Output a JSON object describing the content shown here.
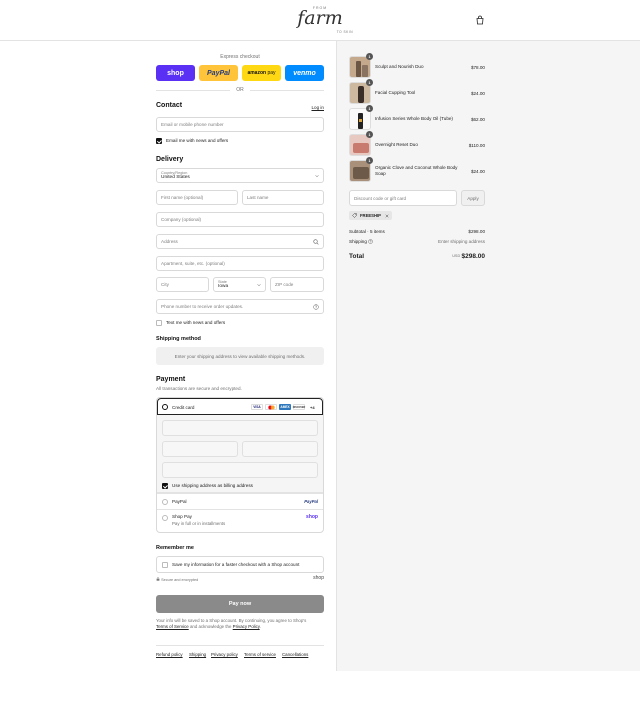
{
  "header": {
    "logo_text": "farm",
    "logo_top": "FROM",
    "logo_bottom": "TO SKIN",
    "cart_icon": "bag-icon"
  },
  "express": {
    "title": "Express checkout",
    "shop_label": "shop",
    "paypal_label": "PayPal",
    "amazon_label": "amazon",
    "amazon_sub": "pay",
    "venmo_label": "venmo",
    "or_label": "OR",
    "colors": {
      "shop": "#5a31f4",
      "paypal": "#ffc439",
      "amazon": "#ffd814",
      "venmo": "#008cff"
    }
  },
  "contact": {
    "heading": "Contact",
    "login_label": "Log in",
    "email_placeholder": "Email or mobile phone number",
    "news_label": "Email me with news and offers",
    "news_checked": true
  },
  "delivery": {
    "heading": "Delivery",
    "country_label": "Country/Region",
    "country_value": "United States",
    "first_name_placeholder": "First name (optional)",
    "last_name_placeholder": "Last name",
    "company_placeholder": "Company (optional)",
    "address_placeholder": "Address",
    "apartment_placeholder": "Apartment, suite, etc. (optional)",
    "city_placeholder": "City",
    "state_label": "State",
    "state_value": "Iowa",
    "zip_placeholder": "ZIP code",
    "phone_placeholder": "Phone number to receive order updates.",
    "text_label": "Text me with news and offers",
    "text_checked": false
  },
  "shipping_method": {
    "heading": "Shipping method",
    "notice": "Enter your shipping address to view available shipping methods."
  },
  "payment": {
    "heading": "Payment",
    "subtitle": "All transactions are secure and encrypted.",
    "credit_card_label": "Credit card",
    "card_brands": [
      "VISA",
      "MC",
      "AMEX",
      "DISCOVER"
    ],
    "more_brands": "+4",
    "billing_label": "Use shipping address as billing address",
    "billing_checked": true,
    "paypal_label": "PayPal",
    "paypal_logo": "PayPal",
    "shoppay_label": "Shop Pay",
    "shoppay_sub": "Pay in full or in installments",
    "shoppay_logo": "shop"
  },
  "remember": {
    "heading": "Remember me",
    "save_label": "Save my information for a faster checkout with a Shop account",
    "secure_label": "Secure and encrypted",
    "shop_logo": "shop"
  },
  "pay_now_label": "Pay now",
  "legal": {
    "line1": "Your info will be saved to a Shop account. By continuing, you agree to Shop's",
    "terms": "Terms of Service",
    "and": "and acknowledge the",
    "privacy": "Privacy Policy",
    "end": "."
  },
  "footer_links": [
    "Refund policy",
    "Shipping",
    "Privacy policy",
    "Terms of service",
    "Cancellations"
  ],
  "cart": {
    "items": [
      {
        "name": "Sculpt and Nourish Duo",
        "price": "$78.00",
        "qty": "1"
      },
      {
        "name": "Facial Cupping Tool",
        "price": "$24.00",
        "qty": "1"
      },
      {
        "name": "Infusion Series Whole Body Oil (Tube)",
        "price": "$62.00",
        "qty": "1"
      },
      {
        "name": "Overnight Reset Duo",
        "price": "$110.00",
        "qty": "1"
      },
      {
        "name": "Organic Clove and Coconut Whole Body Soap",
        "price": "$24.00",
        "qty": "1"
      }
    ],
    "discount_placeholder": "Discount code or gift card",
    "apply_label": "Apply",
    "discount_tag": "FREESHIP",
    "subtotal_label": "Subtotal · 5 items",
    "subtotal_value": "$298.00",
    "shipping_label": "Shipping",
    "shipping_value": "Enter shipping address",
    "total_label": "Total",
    "currency": "USD",
    "total_value": "$298.00"
  }
}
